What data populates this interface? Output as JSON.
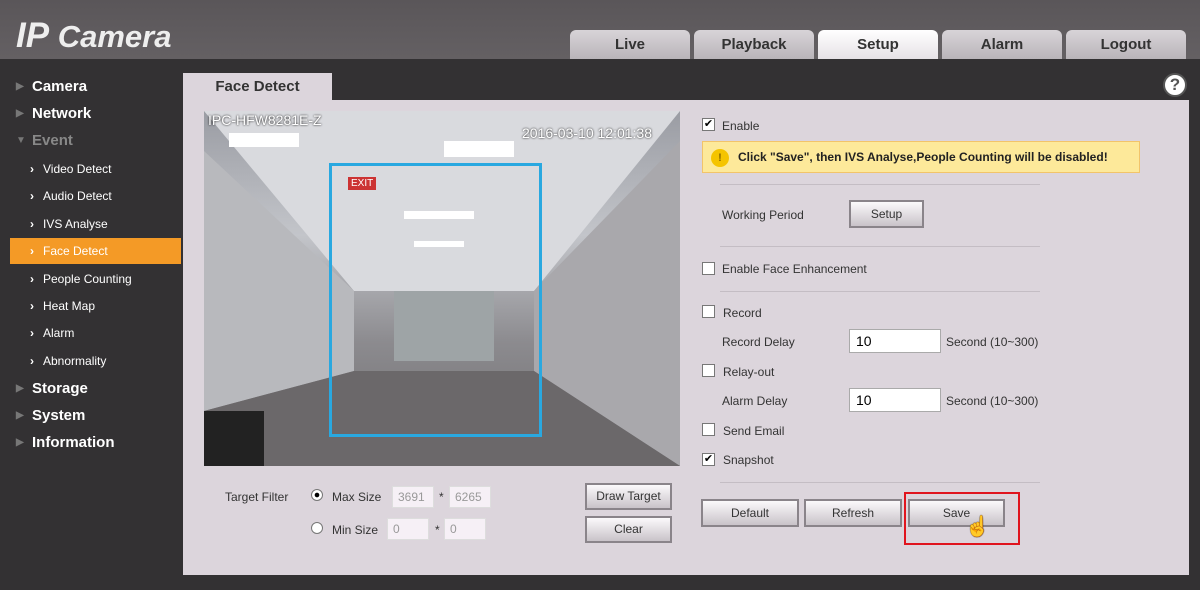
{
  "header": {
    "logo_prefix": "IP",
    "logo_suffix": "Camera",
    "tabs": [
      {
        "label": "Live"
      },
      {
        "label": "Playback"
      },
      {
        "label": "Setup",
        "active": true
      },
      {
        "label": "Alarm"
      },
      {
        "label": "Logout"
      }
    ]
  },
  "sidebar": {
    "items": [
      {
        "label": "Camera",
        "level": 1
      },
      {
        "label": "Network",
        "level": 1
      },
      {
        "label": "Event",
        "level": 1,
        "expanded": true
      },
      {
        "label": "Video Detect",
        "level": 2
      },
      {
        "label": "Audio Detect",
        "level": 2
      },
      {
        "label": "IVS Analyse",
        "level": 2
      },
      {
        "label": "Face Detect",
        "level": 2,
        "active": true
      },
      {
        "label": "People Counting",
        "level": 2
      },
      {
        "label": "Heat Map",
        "level": 2
      },
      {
        "label": "Alarm",
        "level": 2
      },
      {
        "label": "Abnormality",
        "level": 2
      },
      {
        "label": "Storage",
        "level": 1
      },
      {
        "label": "System",
        "level": 1
      },
      {
        "label": "Information",
        "level": 1
      }
    ],
    "active_color": "#f49a26"
  },
  "page": {
    "tab": "Face Detect",
    "help_icon": "?"
  },
  "video": {
    "camera_name": "IPC-HFW8281E-Z",
    "timestamp": "2016-03-10 12:01:38",
    "exit_sign": "EXIT",
    "region_color": "#29a8e0"
  },
  "filter": {
    "label": "Target Filter",
    "max_label": "Max Size",
    "max_w": "3691",
    "max_h": "6265",
    "min_label": "Min Size",
    "min_w": "0",
    "min_h": "0",
    "sep": "*",
    "selected": "max",
    "draw_target": "Draw Target",
    "clear": "Clear"
  },
  "settings": {
    "enable": {
      "label": "Enable",
      "checked": true
    },
    "warning": "Click \"Save\", then IVS Analyse,People Counting will be disabled!",
    "working_period": "Working Period",
    "setup": "Setup",
    "face_enh": {
      "label": "Enable Face Enhancement",
      "checked": false
    },
    "record": {
      "label": "Record",
      "checked": false
    },
    "record_delay": {
      "label": "Record Delay",
      "value": "10",
      "unit": "Second (10~300)"
    },
    "relay": {
      "label": "Relay-out",
      "checked": false
    },
    "alarm_delay": {
      "label": "Alarm Delay",
      "value": "10",
      "unit": "Second (10~300)"
    },
    "email": {
      "label": "Send Email",
      "checked": false
    },
    "snapshot": {
      "label": "Snapshot",
      "checked": true
    },
    "default": "Default",
    "refresh": "Refresh",
    "save": "Save"
  }
}
